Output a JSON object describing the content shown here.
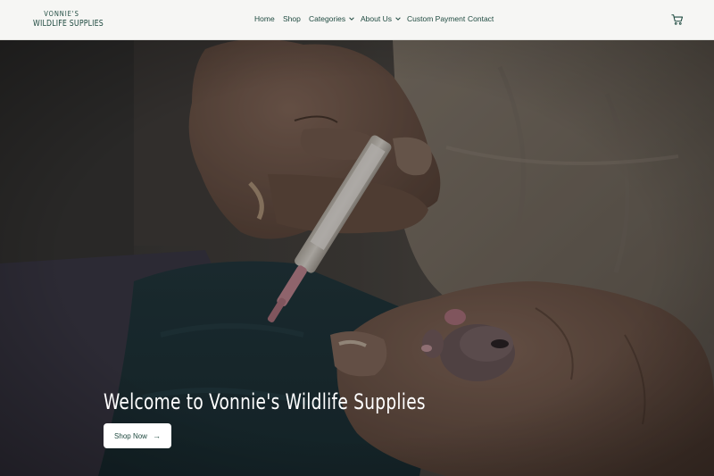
{
  "brand": {
    "line1": "VONNIE'S",
    "line2": "WILDLIFE SUPPLIES"
  },
  "nav": {
    "home": "Home",
    "shop": "Shop",
    "categories": "Categories",
    "about": "About Us",
    "custom_payment": "Custom Payment",
    "contact": "Contact"
  },
  "icons": {
    "cart": "cart-icon",
    "chevron": "chevron-down-icon",
    "arrow": "arrow-right-icon"
  },
  "hero": {
    "title": "Welcome to Vonnie's Wildlife Supplies",
    "button_label": "Shop Now",
    "button_arrow": "→"
  },
  "colors": {
    "brand": "#1f4a40",
    "header_bg": "#f6f6f4",
    "button_bg": "#ffffff"
  }
}
